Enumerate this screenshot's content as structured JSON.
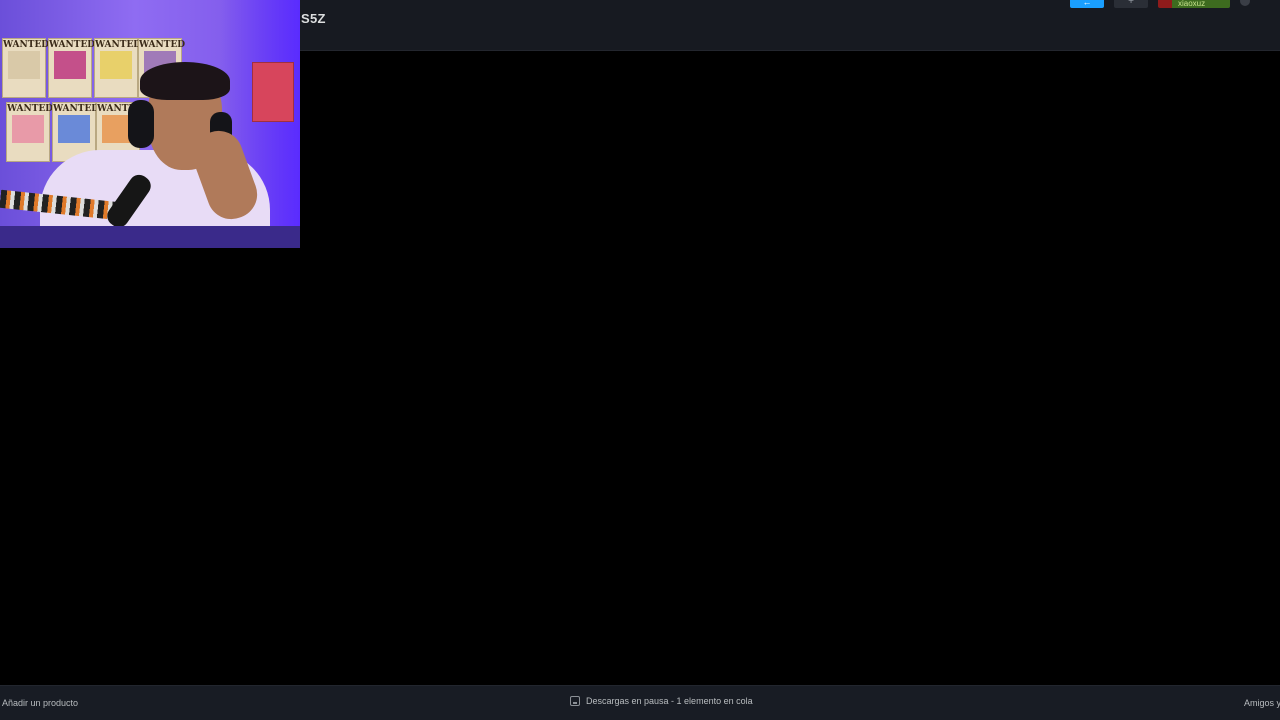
{
  "header": {
    "title": "S5Z",
    "user_name": "xiaoxuz"
  },
  "footer": {
    "add_product": "Añadir un producto",
    "downloads_status": "Descargas en pausa - 1 elemento en cola",
    "friends": "Amigos y chat"
  },
  "webcam": {
    "poster_label": "WANTED"
  },
  "colors": {
    "accent_blue": "#1a9fff",
    "topbar_bg": "#171a21",
    "bottombar_bg": "#181c24",
    "user_green": "#3d6b1f"
  },
  "icons": [
    "back-icon",
    "add-icon",
    "avatar-icon",
    "settings-icon",
    "downloads-icon"
  ]
}
